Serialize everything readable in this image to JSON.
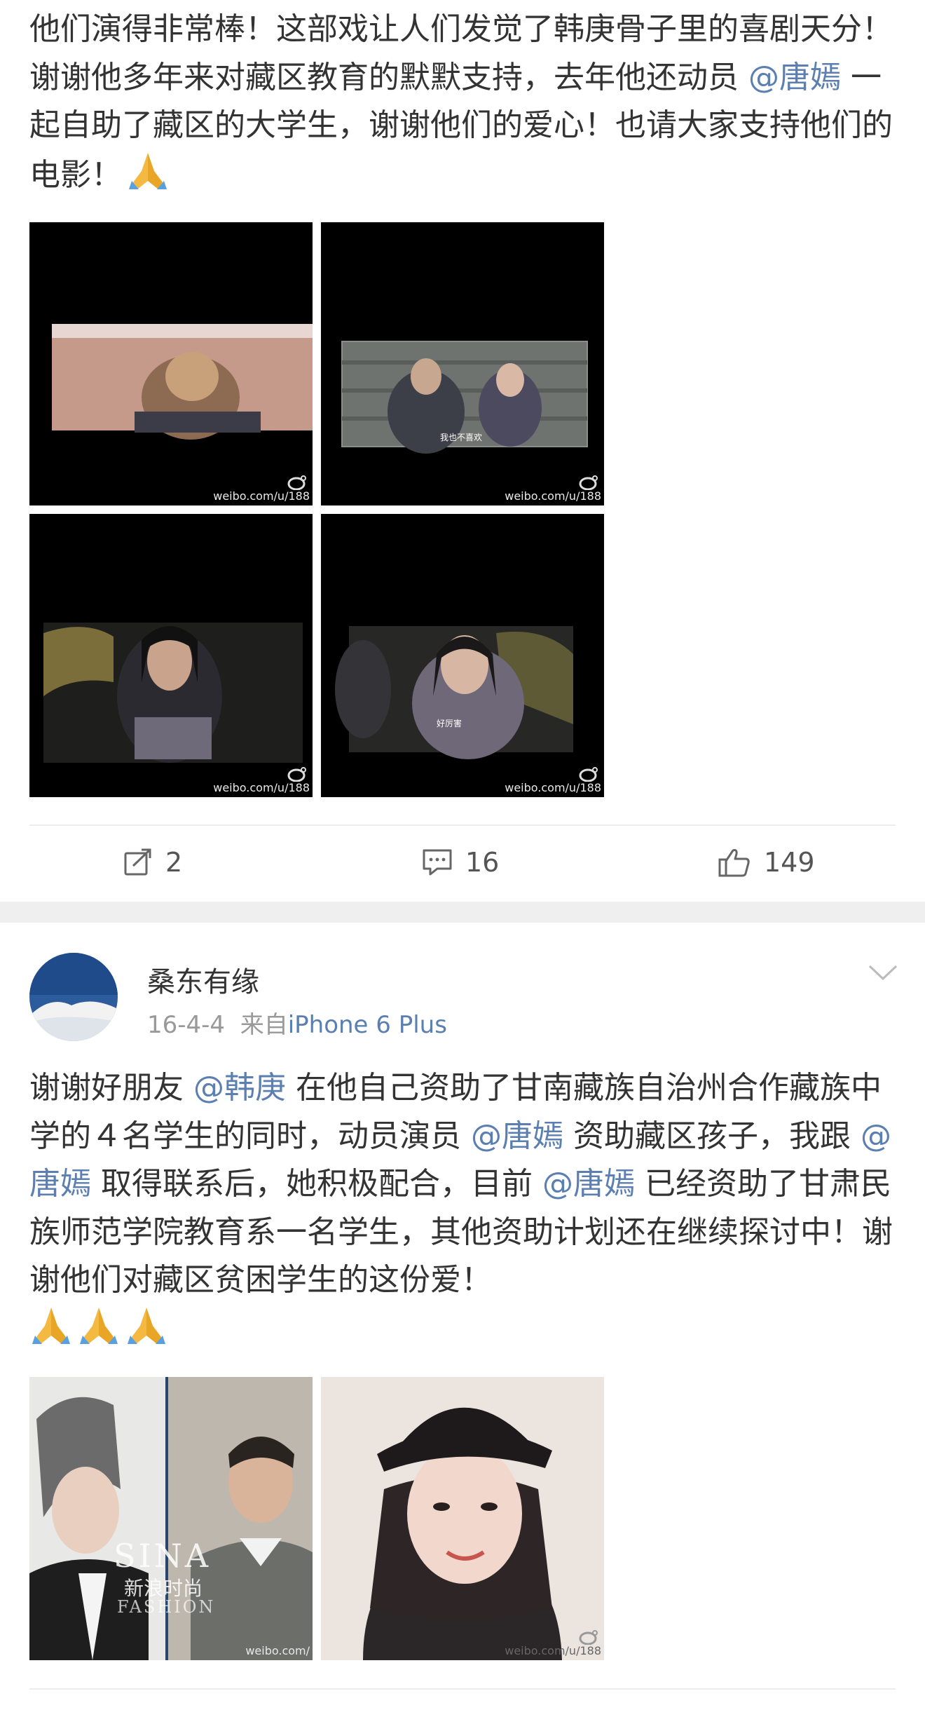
{
  "post1": {
    "text_parts": [
      "他们演得非常棒！这部戏让人们发觉了韩庚骨子里的喜剧天分！谢谢他多年来对藏区教育的默默支持，去年他还动员 ",
      "@唐嫣",
      " 一起自助了藏区的大学生，谢谢他们的爱心！也请大家支持他们的电影！"
    ],
    "emoji": "pray-emoji",
    "photos": [
      {
        "icon": "movie-still-monkey-king",
        "watermark": "weibo.com/u/188"
      },
      {
        "icon": "movie-still-wall-scene",
        "watermark": "weibo.com/u/188",
        "subtitle": "我也不喜欢"
      },
      {
        "icon": "movie-still-man-closeup",
        "watermark": "weibo.com/u/188"
      },
      {
        "icon": "movie-still-woman-closeup",
        "watermark": "weibo.com/u/188",
        "subtitle": "好厉害"
      }
    ],
    "actions": {
      "repost": "2",
      "comment": "16",
      "like": "149"
    }
  },
  "post2": {
    "username": "桑东有缘",
    "date": "16-4-4",
    "source_prefix": "来自",
    "source": "iPhone 6 Plus",
    "text_parts": [
      "谢谢好朋友 ",
      "@韩庚",
      " 在他自己资助了甘南藏族自治州合作藏族中学的４名学生的同时，动员演员 ",
      "@唐嫣",
      " 资助藏区孩子，我跟 ",
      "@唐嫣",
      " 取得联系后，她积极配合，目前 ",
      "@唐嫣",
      " 已经资助了甘肃民族师范学院教育系一名学生，其他资助计划还在继续探讨中！谢谢他们对藏区贫困学生的这份爱！"
    ],
    "emoji_count": "3",
    "photos": [
      {
        "icon": "photo-two-men-fashion",
        "overlay": "SINA",
        "overlay_cn": "新浪时尚",
        "overlay_sub": "FASHION",
        "watermark": "weibo.com/"
      },
      {
        "icon": "photo-woman-hat",
        "watermark": "weibo.com/u/188"
      }
    ]
  },
  "colors": {
    "mention": "#5b7fb1",
    "meta": "#999999",
    "band": "#efefef"
  }
}
